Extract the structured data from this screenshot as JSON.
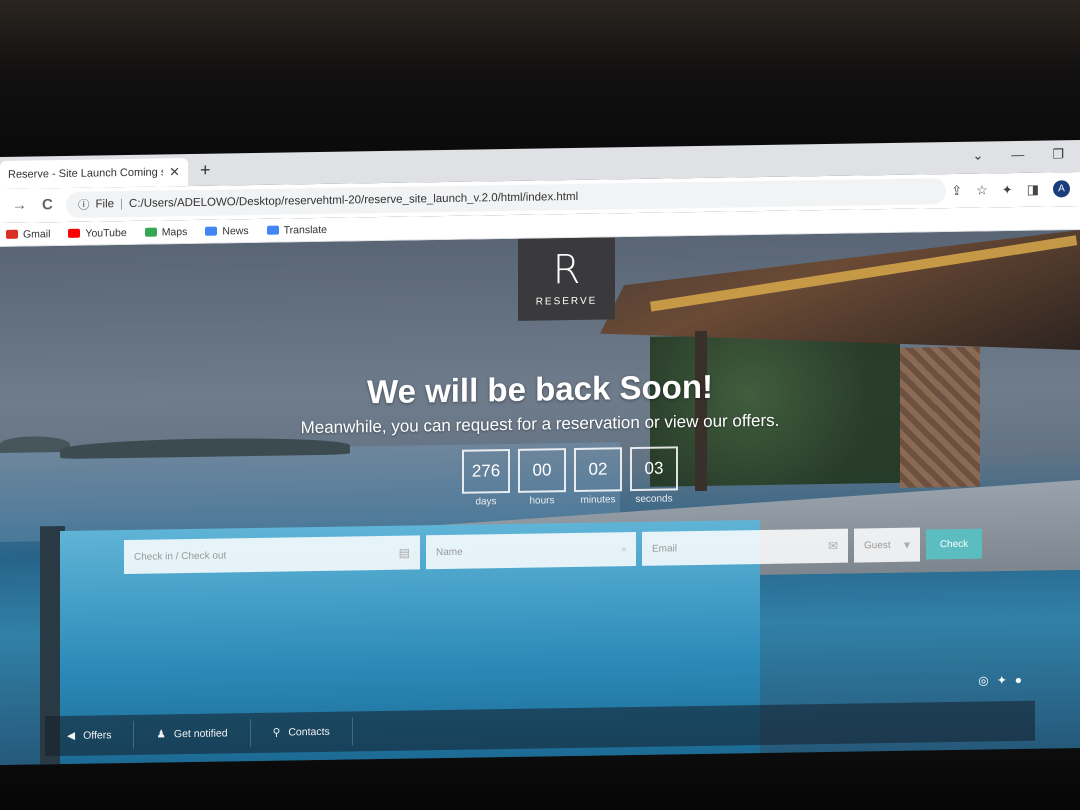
{
  "browser": {
    "tab_title": "Reserve - Site Launch Coming so",
    "tab_close": "✕",
    "new_tab": "+",
    "window_controls": [
      "⌄",
      "—",
      "❐"
    ],
    "back": "→",
    "reload": "C",
    "info": "ⓘ",
    "scheme_label": "File",
    "url": "C:/Users/ADELOWO/Desktop/reservehtml-20/reserve_site_launch_v.2.0/html/index.html",
    "toolbar_icons": [
      "⇪",
      "☆",
      "✦",
      "◨"
    ],
    "avatar_letter": "A",
    "bookmarks": [
      {
        "label": "Gmail",
        "color": "#d93025"
      },
      {
        "label": "YouTube",
        "color": "#ff0000"
      },
      {
        "label": "Maps",
        "color": "#34a853"
      },
      {
        "label": "News",
        "color": "#4285f4"
      },
      {
        "label": "Translate",
        "color": "#4285f4"
      }
    ]
  },
  "page": {
    "logo_letter": "R",
    "logo_name": "RESERVE",
    "headline": "We will be back Soon!",
    "subheadline": "Meanwhile, you can request for a reservation or view our offers.",
    "countdown": [
      {
        "value": "276",
        "label": "days"
      },
      {
        "value": "00",
        "label": "hours"
      },
      {
        "value": "02",
        "label": "minutes"
      },
      {
        "value": "03",
        "label": "seconds"
      }
    ],
    "form": {
      "checkin_placeholder": "Check in / Check out",
      "name_placeholder": "Name",
      "email_placeholder": "Email",
      "guest_placeholder": "Guest",
      "submit_label": "Check"
    },
    "social": [
      "◎",
      "✦",
      "●"
    ],
    "footer": [
      {
        "icon": "◀",
        "label": "Offers"
      },
      {
        "icon": "♟",
        "label": "Get notified"
      },
      {
        "icon": "⚲",
        "label": "Contacts"
      }
    ]
  }
}
